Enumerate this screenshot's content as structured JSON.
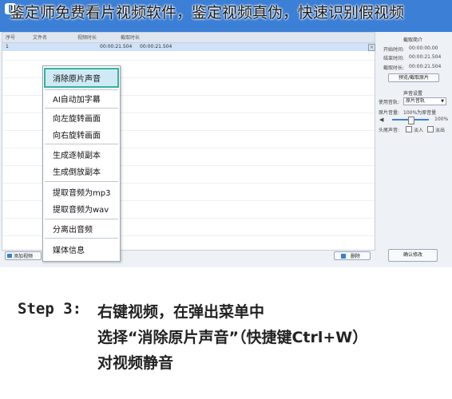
{
  "headline": "鉴定师免费看片视频软件，鉴定视频真伪，快速识别假视频",
  "table": {
    "headers": [
      "序号",
      "文件名",
      "视频时长",
      "截取时长"
    ],
    "rows": [
      {
        "no": "1",
        "name": "",
        "duration": "00:00:21.504",
        "clip": "00:00:21.504"
      }
    ]
  },
  "right_panel": {
    "clip_title": "截取简介",
    "start_label": "开始时间:",
    "start_value": "00:00:00.00",
    "end_label": "结束时间:",
    "end_value": "00:00:21.504",
    "length_label": "截取时长:",
    "length_value": "00:00:21.504",
    "preview_button": "预览/截取原片",
    "audio_title": "声音设置",
    "audio_track_label": "使用音轨:",
    "audio_track_value": "原片音轨",
    "volume_label": "原片音量:",
    "volume_note": "100%为原音量",
    "volume_value": "100%",
    "volume_level": 0.5,
    "fade_label": "头尾声音:",
    "fade_in": "淡入",
    "fade_out": "淡出",
    "confirm_button": "确认修改"
  },
  "toolbar": {
    "add_label": "添加视频",
    "delete_label": "删除"
  },
  "context_menu": {
    "items": [
      "消除原片声音",
      "AI自动加字幕",
      "向左旋转画面",
      "向右旋转画面",
      "生成逐帧副本",
      "生成倒放副本",
      "提取音频为mp3",
      "提取音频为wav",
      "分离出音频",
      "媒体信息"
    ],
    "highlighted_index": 0
  },
  "caption": {
    "label": "Step 3:",
    "line1": "右键视频，在弹出菜单中",
    "line2": "选择“消除原片声音”（快捷键Ctrl+W）",
    "line3": "对视频静音"
  },
  "colors": {
    "accent": "#3b7fd6",
    "highlight_border": "#34b39b",
    "highlight_fill": "#cfeaf5"
  }
}
